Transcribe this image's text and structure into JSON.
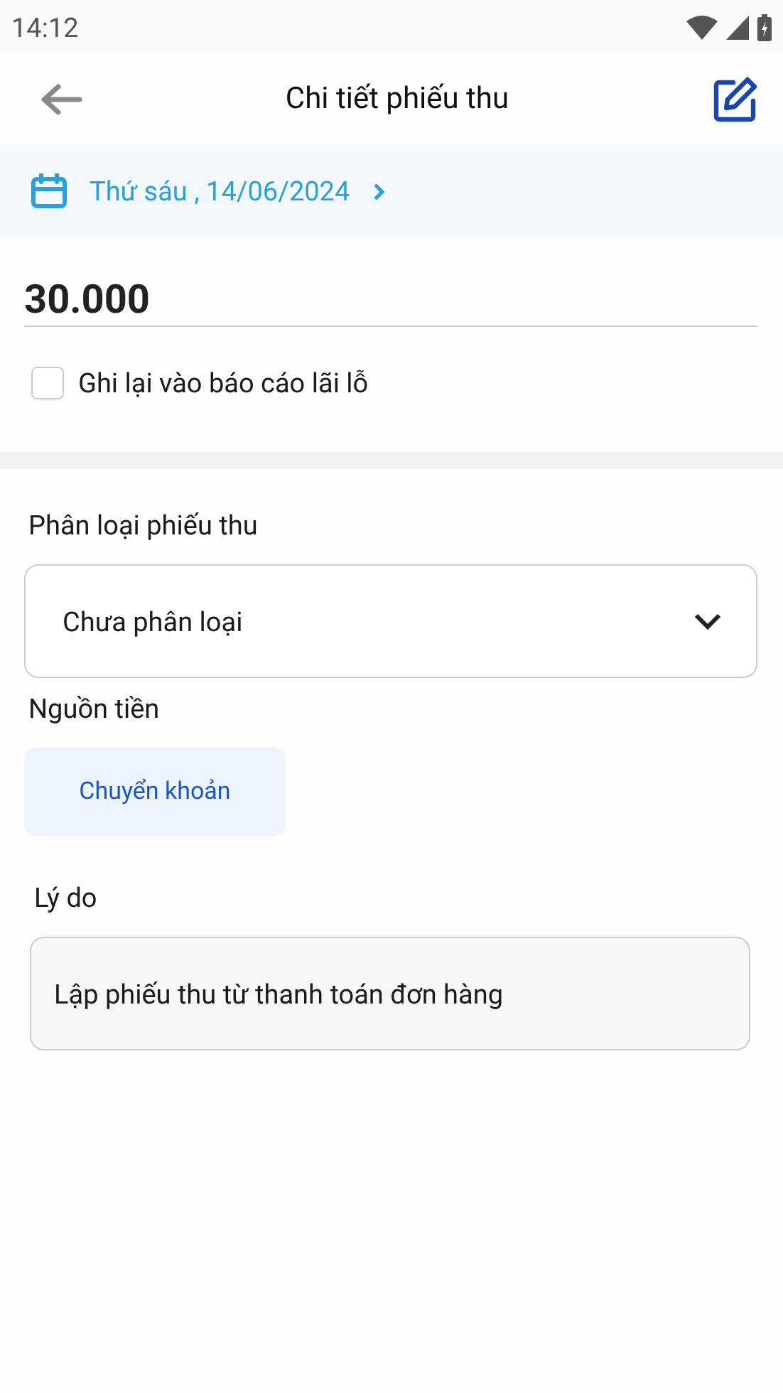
{
  "status_bar": {
    "time": "14:12"
  },
  "header": {
    "title": "Chi tiết phiếu thu"
  },
  "date_bar": {
    "date": "Thứ sáu , 14/06/2024"
  },
  "amount": {
    "value": "30.000"
  },
  "record_option": {
    "label": "Ghi lại vào báo cáo lãi lỗ",
    "checked": false
  },
  "category": {
    "label": "Phân loại phiếu thu",
    "value": "Chưa phân loại"
  },
  "source": {
    "label": "Nguồn tiền",
    "options": [
      {
        "label": "Chuyển khoản",
        "selected": true
      }
    ]
  },
  "reason": {
    "label": "Lý do",
    "value": "Lập phiếu thu từ thanh toán đơn hàng"
  }
}
